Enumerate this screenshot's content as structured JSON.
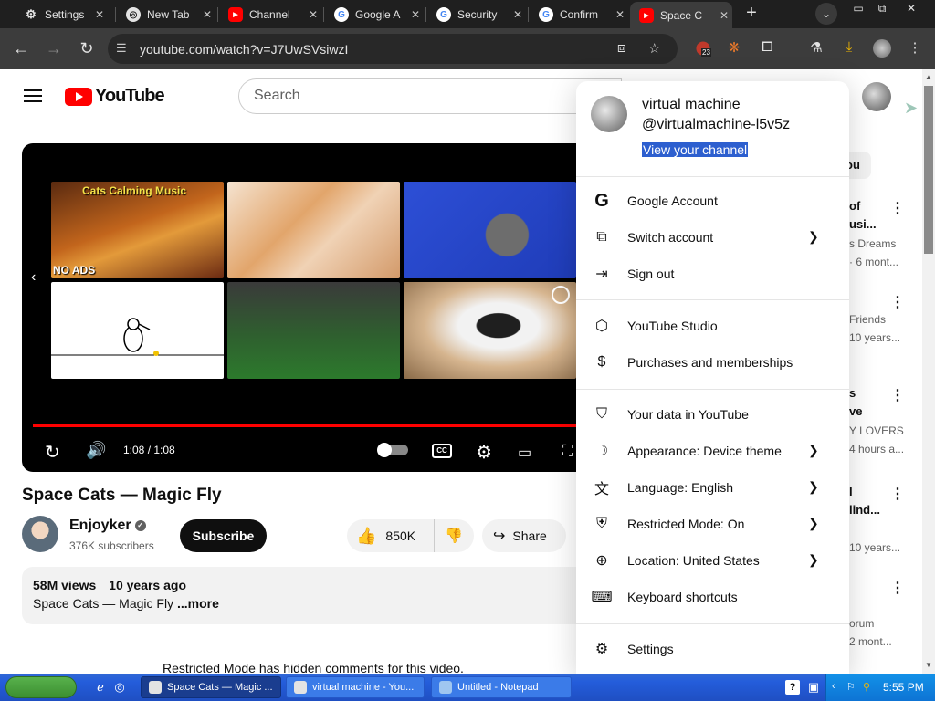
{
  "browser": {
    "tabs": [
      {
        "title": "Settings",
        "icon": "gear-icon"
      },
      {
        "title": "New Tab",
        "icon": "chrome-icon"
      },
      {
        "title": "Channel",
        "icon": "youtube-icon"
      },
      {
        "title": "Google A",
        "icon": "google-icon"
      },
      {
        "title": "Security",
        "icon": "google-icon"
      },
      {
        "title": "Confirm",
        "icon": "google-icon"
      },
      {
        "title": "Space C",
        "icon": "youtube-icon"
      }
    ],
    "url": "youtube.com/watch?v=J7UwSVsiwzI",
    "extension_badge": "23"
  },
  "youtube": {
    "logo_text": "YouTube",
    "search_placeholder": "Search",
    "player": {
      "thumbnail_caption_1": "Cats Calming Music",
      "thumbnail_caption_2": "NO ADS",
      "time": "1:08 / 1:08",
      "progress": 1.0,
      "cc_label": "CC"
    },
    "video": {
      "title": "Space Cats — Magic Fly",
      "channel": "Enjoyker",
      "subscribers": "376K subscribers",
      "subscribe_label": "Subscribe",
      "likes": "850K",
      "share_label": "Share",
      "views": "58M views",
      "age": "10 years ago",
      "description": "Space Cats — Magic Fly",
      "more_label": "...more"
    },
    "restricted_notice": "Restricted Mode has hidden comments for this video.",
    "sidebar_chip": "ou",
    "sidebar": [
      {
        "line1": "of",
        "line2": "usi...",
        "line3": "s Dreams",
        "line4": "· 6 mont..."
      },
      {
        "line1": "",
        "line2": "",
        "line3": "Friends",
        "line4": "10 years..."
      },
      {
        "line1": "s",
        "line2": "ve",
        "line3": "Y LOVERS",
        "line4": "4 hours a..."
      },
      {
        "line1": "l",
        "line2": "lind...",
        "line3": "",
        "line4": "10 years..."
      },
      {
        "line1": "",
        "line2": "",
        "line3": "orum",
        "line4": "2 mont..."
      }
    ]
  },
  "account_menu": {
    "name": "virtual machine",
    "handle": "@virtualmachine-l5v5z",
    "view_channel": "View your channel",
    "items": [
      {
        "label": "Google Account",
        "icon": "google-g-icon",
        "chevron": false
      },
      {
        "label": "Switch account",
        "icon": "switch-account-icon",
        "chevron": true
      },
      {
        "label": "Sign out",
        "icon": "sign-out-icon",
        "chevron": false
      },
      {
        "label": "YouTube Studio",
        "icon": "studio-icon",
        "chevron": false
      },
      {
        "label": "Purchases and memberships",
        "icon": "dollar-icon",
        "chevron": false
      },
      {
        "label": "Your data in YouTube",
        "icon": "shield-person-icon",
        "chevron": false
      },
      {
        "label": "Appearance: Device theme",
        "icon": "moon-icon",
        "chevron": true
      },
      {
        "label": "Language: English",
        "icon": "translate-icon",
        "chevron": true
      },
      {
        "label": "Restricted Mode: On",
        "icon": "restricted-icon",
        "chevron": true
      },
      {
        "label": "Location: United States",
        "icon": "globe-icon",
        "chevron": true
      },
      {
        "label": "Keyboard shortcuts",
        "icon": "keyboard-icon",
        "chevron": false
      },
      {
        "label": "Settings",
        "icon": "gear-icon",
        "chevron": false
      }
    ]
  },
  "taskbar": {
    "tasks": [
      {
        "label": "Space Cats — Magic ...",
        "active": true
      },
      {
        "label": "virtual machine - You...",
        "active": false
      },
      {
        "label": "Untitled - Notepad",
        "active": false
      }
    ],
    "clock": "5:55 PM"
  },
  "colors": {
    "youtube_red": "#ff0000",
    "browser_dark": "#3c3c3c",
    "selection_blue": "#2d5fcf",
    "taskbar_blue": "#245ddb"
  }
}
